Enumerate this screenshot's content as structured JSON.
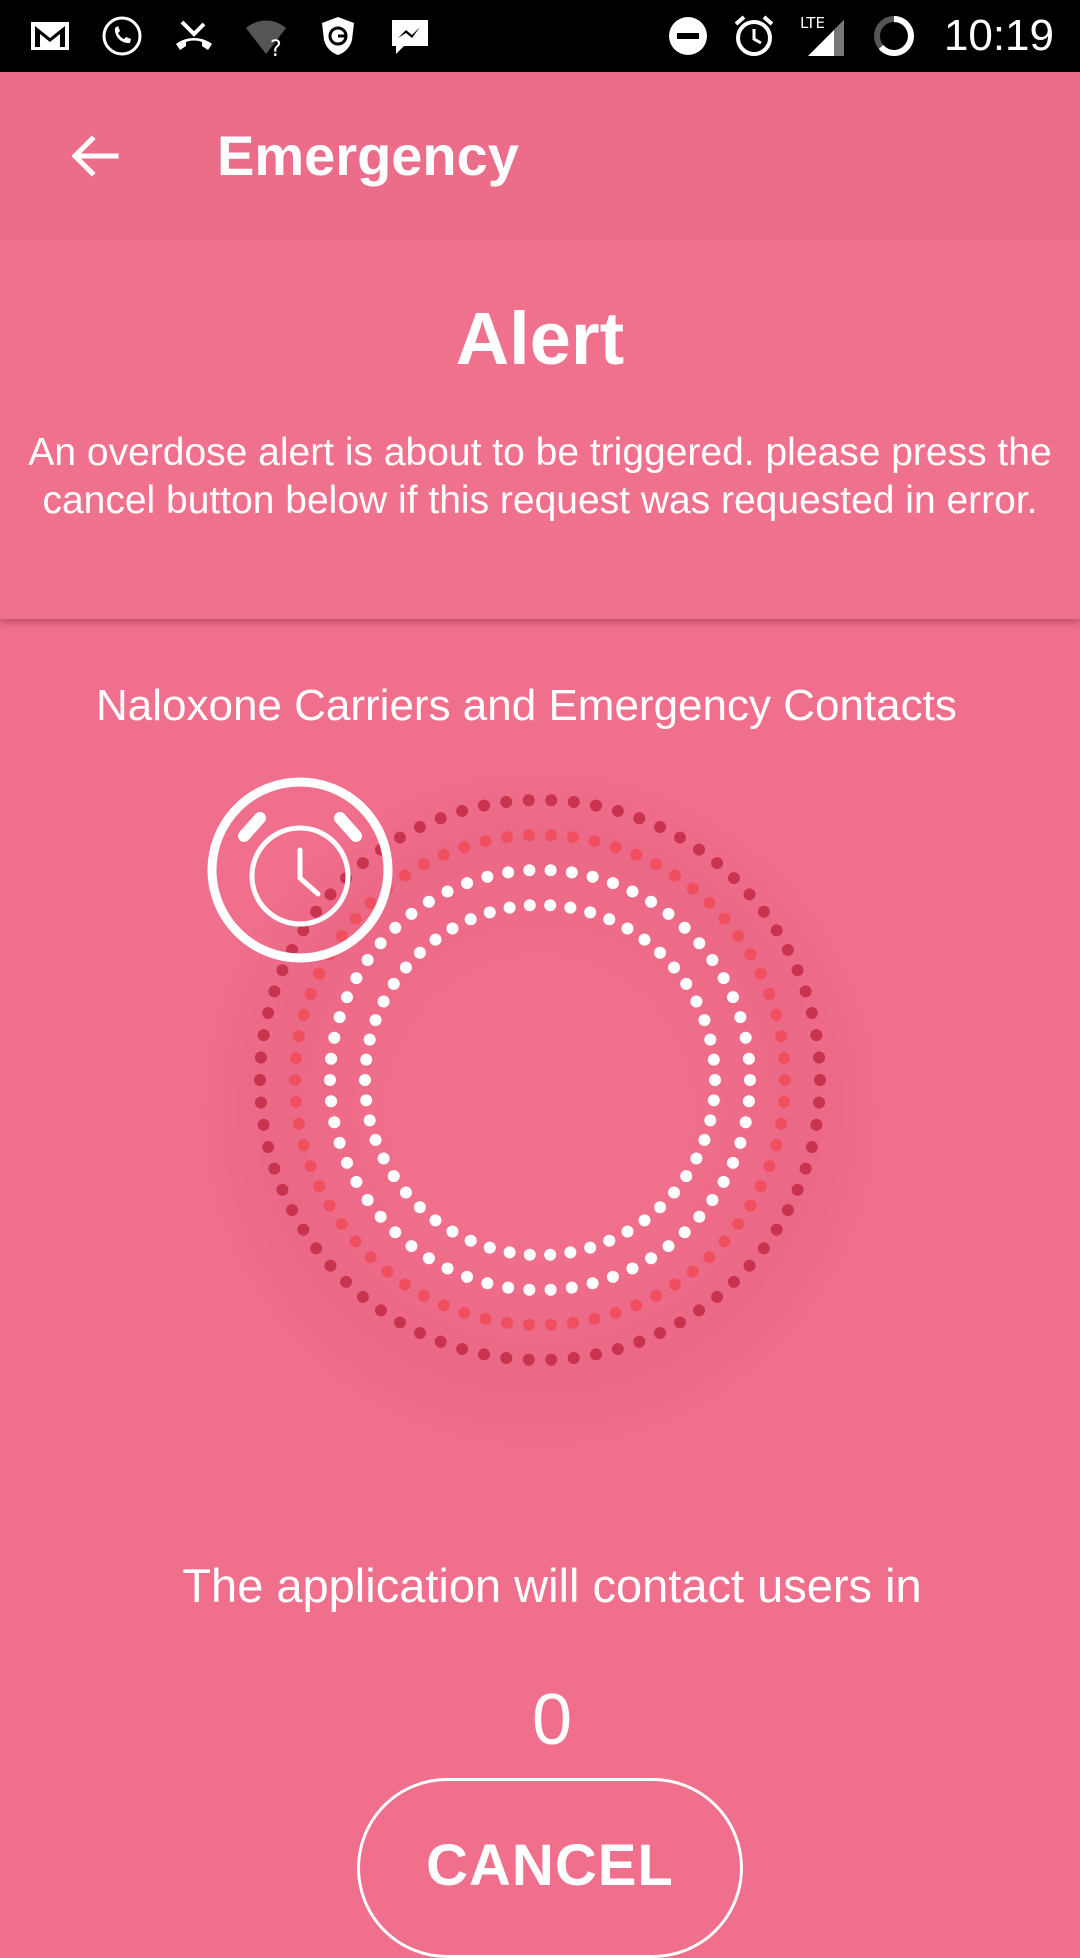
{
  "status_bar": {
    "time": "10:19",
    "network": "LTE",
    "left_icons": [
      "gmail-icon",
      "phone-call-icon",
      "missed-call-icon",
      "wifi-unknown-icon",
      "vpn-shield-icon",
      "messenger-icon"
    ],
    "right_icons": [
      "do-not-disturb-icon",
      "alarm-icon",
      "signal-icon",
      "battery-icon"
    ]
  },
  "appbar": {
    "title": "Emergency"
  },
  "alert": {
    "title": "Alert",
    "message": "An overdose alert is about to be triggered. please press the cancel button below if this request was requested in error."
  },
  "carriers_heading": "Naloxone Carriers and Emergency Contacts",
  "countdown": {
    "label": "The application will contact users in",
    "value": "0"
  },
  "cancel_button": {
    "label": "CANCEL"
  },
  "colors": {
    "background": "#ef6f8c",
    "ring_outer": "#c8334f",
    "ring_middle": "#ef4f5e",
    "ring_inner": "#ffffff"
  }
}
